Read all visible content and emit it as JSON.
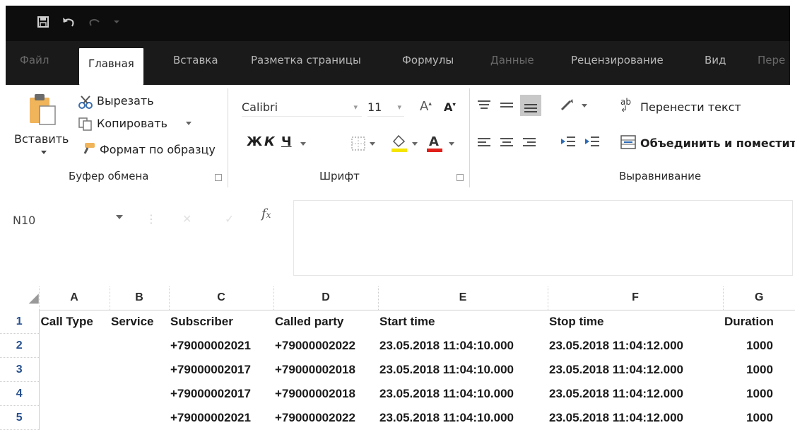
{
  "qat": {
    "save_icon": "save-icon",
    "undo_icon": "undo-icon",
    "redo_icon": "redo-icon",
    "customize_icon": "customize-qat-icon"
  },
  "tabs": [
    {
      "label": "Файл"
    },
    {
      "label": "Главная"
    },
    {
      "label": "Вставка"
    },
    {
      "label": "Разметка страницы"
    },
    {
      "label": "Формулы"
    },
    {
      "label": "Данные"
    },
    {
      "label": "Рецензирование"
    },
    {
      "label": "Вид"
    },
    {
      "label": "Пере"
    }
  ],
  "clipboard": {
    "paste_label": "Вставить",
    "cut_label": "Вырезать",
    "copy_label": "Копировать",
    "format_painter_label": "Формат по образцу",
    "group_label": "Буфер обмена"
  },
  "font": {
    "family": "Calibri",
    "size": "11",
    "bold": "Ж",
    "italic": "К",
    "underline": "Ч",
    "group_label": "Шрифт"
  },
  "alignment": {
    "wrap_label": "Перенести текст",
    "merge_label": "Объединить и поместить",
    "group_label": "Выравнивание"
  },
  "formula_bar": {
    "name_box": "N10",
    "fx": "fx",
    "value": ""
  },
  "sheet": {
    "column_headers": [
      "A",
      "B",
      "C",
      "D",
      "E",
      "F",
      "G"
    ],
    "rows": [
      {
        "n": "1",
        "cells": [
          "Call Type",
          "Service",
          "Subscriber",
          "Called party",
          "Start time",
          "Stop time",
          "Duration"
        ]
      },
      {
        "n": "2",
        "cells": [
          "",
          "",
          "+79000002021",
          "+79000002022",
          "23.05.2018 11:04:10.000",
          "23.05.2018 11:04:12.000",
          "1000"
        ]
      },
      {
        "n": "3",
        "cells": [
          "",
          "",
          "+79000002017",
          "+79000002018",
          "23.05.2018 11:04:10.000",
          "23.05.2018 11:04:12.000",
          "1000"
        ]
      },
      {
        "n": "4",
        "cells": [
          "",
          "",
          "+79000002017",
          "+79000002018",
          "23.05.2018 11:04:10.000",
          "23.05.2018 11:04:12.000",
          "1000"
        ]
      },
      {
        "n": "5",
        "cells": [
          "",
          "",
          "+79000002021",
          "+79000002022",
          "23.05.2018 11:04:10.000",
          "23.05.2018 11:04:12.000",
          "1000"
        ]
      }
    ]
  },
  "colors": {
    "titlebar": "#0d0d0d",
    "menubar": "#1a1a1a",
    "row_header": "#27508f"
  }
}
